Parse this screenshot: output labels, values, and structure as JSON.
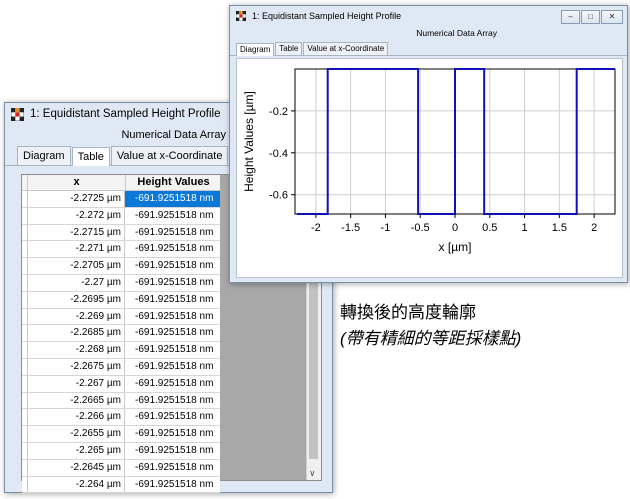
{
  "table_window": {
    "title": "1: Equidistant Sampled Height Profile",
    "subheader": "Numerical Data Array",
    "tabs": [
      "Diagram",
      "Table",
      "Value at x-Coordinate"
    ],
    "active_tab": 1,
    "columns": [
      "x",
      "Height Values"
    ],
    "rows": [
      [
        "-2.2725 µm",
        "-691.9251518 nm"
      ],
      [
        "-2.272 µm",
        "-691.9251518 nm"
      ],
      [
        "-2.2715 µm",
        "-691.9251518 nm"
      ],
      [
        "-2.271 µm",
        "-691.9251518 nm"
      ],
      [
        "-2.2705 µm",
        "-691.9251518 nm"
      ],
      [
        "-2.27 µm",
        "-691.9251518 nm"
      ],
      [
        "-2.2695 µm",
        "-691.9251518 nm"
      ],
      [
        "-2.269 µm",
        "-691.9251518 nm"
      ],
      [
        "-2.2685 µm",
        "-691.9251518 nm"
      ],
      [
        "-2.268 µm",
        "-691.9251518 nm"
      ],
      [
        "-2.2675 µm",
        "-691.9251518 nm"
      ],
      [
        "-2.267 µm",
        "-691.9251518 nm"
      ],
      [
        "-2.2665 µm",
        "-691.9251518 nm"
      ],
      [
        "-2.266 µm",
        "-691.9251518 nm"
      ],
      [
        "-2.2655 µm",
        "-691.9251518 nm"
      ],
      [
        "-2.265 µm",
        "-691.9251518 nm"
      ],
      [
        "-2.2645 µm",
        "-691.9251518 nm"
      ],
      [
        "-2.264 µm",
        "-691.9251518 nm"
      ]
    ],
    "selected_row": 0
  },
  "diagram_window": {
    "title": "1: Equidistant Sampled Height Profile",
    "subheader": "Numerical Data Array",
    "tabs": [
      "Diagram",
      "Table",
      "Value at x-Coordinate"
    ],
    "active_tab": 0
  },
  "chart_data": {
    "type": "line",
    "xlabel": "x [µm]",
    "ylabel": "Height Values [µm]",
    "xlim": [
      -2.3,
      2.3
    ],
    "ylim": [
      -0.692,
      0
    ],
    "xticks": [
      -2,
      -1.5,
      -1,
      -0.5,
      0,
      0.5,
      1,
      1.5,
      2
    ],
    "xtick_labels": [
      "-2",
      "-1.5",
      "-1",
      "-0.5",
      "0",
      "0.5",
      "1",
      "1.5",
      "2"
    ],
    "yticks": [
      -0.2,
      -0.4,
      -0.6
    ],
    "ytick_labels": [
      "-0.2",
      "-0.4",
      "-0.6"
    ],
    "grid": true,
    "series_color": "#1010b8",
    "series": [
      {
        "x": [
          -2.2725,
          -1.83,
          -1.83,
          -0.53,
          -0.53,
          0.0,
          0.0,
          0.42,
          0.42,
          1.75,
          1.75,
          2.3
        ],
        "y": [
          -0.692,
          -0.692,
          0,
          0,
          -0.692,
          -0.692,
          0,
          0,
          -0.692,
          -0.692,
          0,
          0
        ]
      }
    ]
  },
  "caption": {
    "line1": "轉換後的高度輪廓",
    "line2": "(帶有精細的等距採樣點)"
  }
}
